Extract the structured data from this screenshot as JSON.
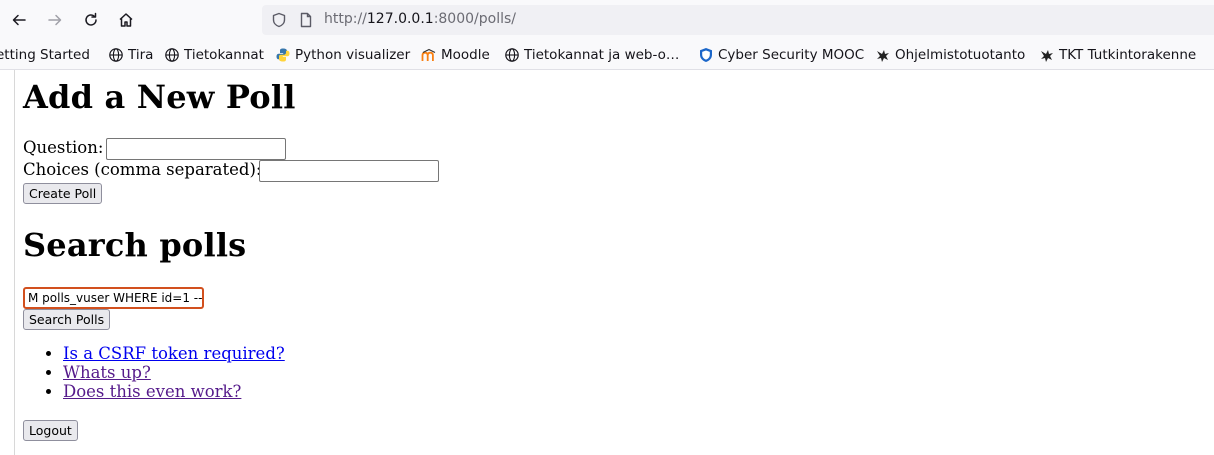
{
  "browser": {
    "url_prefix": "http://",
    "url_host": "127.0.0.1",
    "url_rest": ":8000/polls/",
    "bookmarks": [
      {
        "label": "etting Started",
        "icon": "none"
      },
      {
        "label": "Tira",
        "icon": "globe-icon"
      },
      {
        "label": "Tietokannat",
        "icon": "globe-icon"
      },
      {
        "label": "Python visualizer",
        "icon": "python-icon"
      },
      {
        "label": "Moodle",
        "icon": "moodle-icon"
      },
      {
        "label": "Tietokannat ja web-o…",
        "icon": "globe-icon"
      },
      {
        "label": "Cyber Security MOOC",
        "icon": "shield-icon"
      },
      {
        "label": "Ohjelmistotuotanto",
        "icon": "bird-icon"
      },
      {
        "label": "TKT Tutkintorakenne",
        "icon": "bird-icon"
      }
    ]
  },
  "add_poll": {
    "heading": "Add a New Poll",
    "question_label": "Question:",
    "question_value": "",
    "choices_label": "Choices (comma separated):",
    "choices_value": "",
    "submit_label": "Create Poll"
  },
  "search": {
    "heading": "Search polls",
    "query_value": "M polls_vuser WHERE id=1 --",
    "submit_label": "Search Polls"
  },
  "links": [
    {
      "label": "Is a CSRF token required?",
      "visited": false
    },
    {
      "label": "Whats up?",
      "visited": true
    },
    {
      "label": "Does this even work?",
      "visited": true
    }
  ],
  "logout_label": "Logout",
  "colors": {
    "focus_ring": "#d2501e",
    "link_unvisited": "#0000ee",
    "link_visited": "#551a8b"
  }
}
